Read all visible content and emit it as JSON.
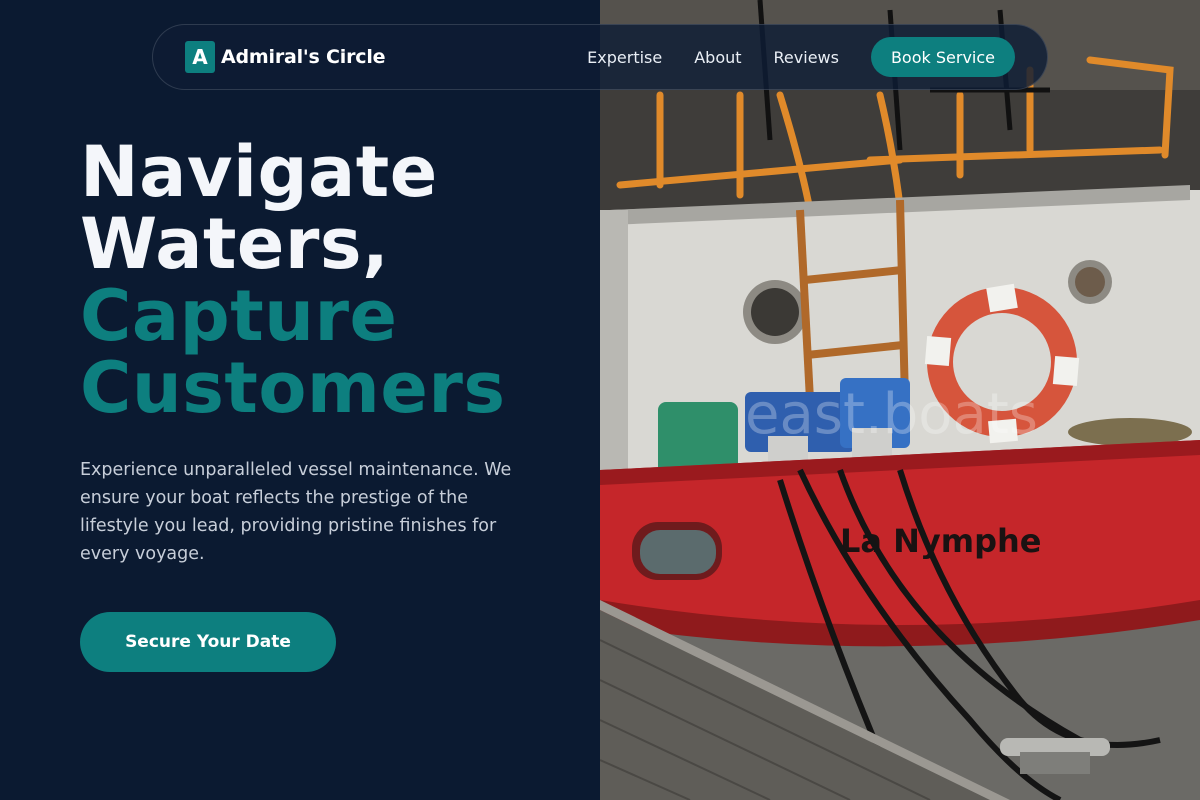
{
  "brand": {
    "mark": "A",
    "name": "Admiral's Circle"
  },
  "nav": {
    "links": [
      "Expertise",
      "About",
      "Reviews"
    ],
    "cta_label": "Book Service"
  },
  "hero": {
    "line1": "Navigate",
    "line2": "Waters,",
    "line3": "Capture",
    "line4": "Customers",
    "description": "Experience unparalleled vessel maintenance. We ensure your boat reflects the prestige of the lifestyle you lead, providing pristine finishes for every voyage.",
    "cta_label": "Secure Your Date"
  },
  "photo": {
    "boat_name": "La Nymphe",
    "watermark": "east.boats"
  },
  "colors": {
    "background": "#0b1a31",
    "accent": "#0d7f7f",
    "heading": "#f4f6fa",
    "body_text": "#c7ced9"
  }
}
